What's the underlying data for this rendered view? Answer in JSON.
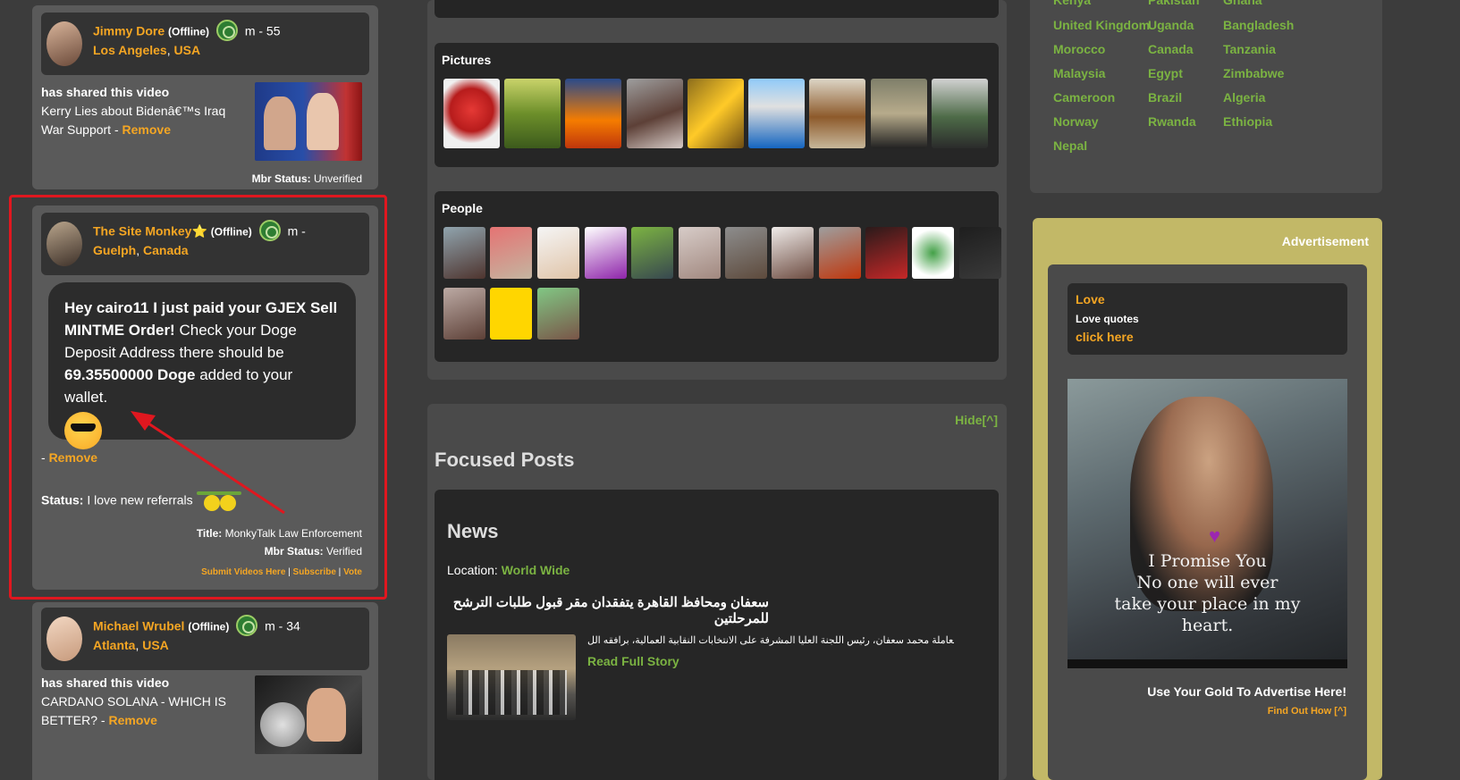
{
  "feed": [
    {
      "name": "Jimmy Dore",
      "offline": "(Offline)",
      "gender_age": "m - 55",
      "city": "Los Angeles",
      "country": "USA",
      "shared_heading": "has shared this video",
      "shared_title": "Kerry Lies about Bidenâ€™s Iraq War Support -",
      "remove": "Remove",
      "mbr_label": "Mbr Status:",
      "mbr_value": "Unverified"
    },
    {
      "name": "The Site Monkey",
      "star": "⭐",
      "offline": "(Offline)",
      "gender_age": "m -",
      "city": "Guelph",
      "country": "Canada",
      "message_bold1": "Hey cairo11 I just paid your GJEX Sell MINTME Order!",
      "message_normal1": " Check your Doge Deposit Address there should be ",
      "message_bold2": "69.35500000 Doge",
      "message_normal2": " added to your wallet.",
      "remove_prefix": "- ",
      "remove": "Remove",
      "status_label": "Status:",
      "status_value": " I love new referrals ",
      "title_label": "Title:",
      "title_value": " MonkyTalk Law Enforcement",
      "mbr_label": "Mbr Status:",
      "mbr_value": " Verified",
      "link_submit": "Submit Videos Here",
      "link_subscribe": "Subscribe",
      "link_vote": "Vote",
      "sep": " | "
    },
    {
      "name": "Michael Wrubel",
      "offline": "(Offline)",
      "gender_age": "m - 34",
      "city": "Atlanta",
      "country": "USA",
      "shared_heading": "has shared this video",
      "shared_title": "CARDANO SOLANA - WHICH IS BETTER? -",
      "remove": "Remove"
    }
  ],
  "pictures": {
    "title": "Pictures"
  },
  "people": {
    "title": "People"
  },
  "focused": {
    "hide": "Hide[^]",
    "title": "Focused Posts",
    "news_heading": "News",
    "location_label": "Location:",
    "location_value": "World Wide",
    "arabic_title": "سعفان ومحافظ القاهرة يتفقدان مقر قبول طلبات الترشح للمرحلتين",
    "arabic_text": "تفقد وزير القوى العاملة محمد سعفان، رئيس اللجنة العليا المشرفة على الانتخابات النقابية العمالية، برافقه الل�",
    "read_more": "Read Full Story"
  },
  "countries": [
    [
      "Kenya",
      "Pakistan",
      "Ghana"
    ],
    [
      "United Kingdom",
      "Uganda",
      "Bangladesh"
    ],
    [
      "Morocco",
      "Canada",
      "Tanzania"
    ],
    [
      "Malaysia",
      "Egypt",
      "Zimbabwe"
    ],
    [
      "Cameroon",
      "Brazil",
      "Algeria"
    ],
    [
      "Norway",
      "Rwanda",
      "Ethiopia"
    ],
    [
      "Nepal",
      "",
      ""
    ]
  ],
  "ad": {
    "title": "Advertisement",
    "love_title": "Love",
    "love_sub": "Love quotes",
    "love_link": "click here",
    "caption_1": "I Promise You",
    "caption_2": "No one will ever",
    "caption_3": "take your place in my",
    "caption_4": "heart.",
    "use_gold": "Use Your Gold To Advertise Here!",
    "find_out": "Find Out How [^]"
  },
  "colors": {
    "accent_orange": "#f5a623",
    "accent_green": "#7bb342",
    "highlight_red": "#e0171f",
    "ad_bg": "#c2b867"
  }
}
